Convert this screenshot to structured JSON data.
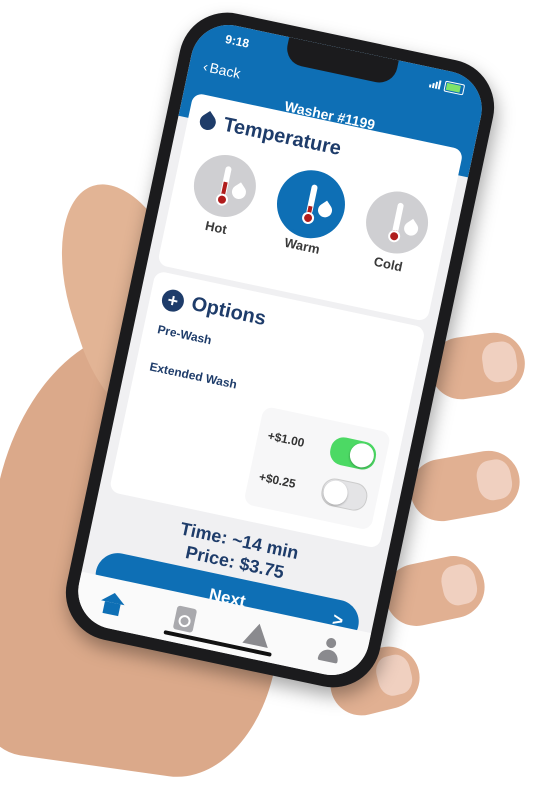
{
  "status": {
    "time": "9:18"
  },
  "header": {
    "back_label": "Back",
    "title": "Washer #1199"
  },
  "temperature": {
    "title": "Temperature",
    "options": [
      {
        "label": "Hot",
        "selected": false,
        "level": 0.75
      },
      {
        "label": "Warm",
        "selected": true,
        "level": 0.5
      },
      {
        "label": "Cold",
        "selected": false,
        "level": 0.25
      }
    ]
  },
  "options": {
    "title": "Options",
    "items": [
      {
        "label": "Pre-Wash",
        "price": "+$1.00",
        "enabled": true
      },
      {
        "label": "Extended Wash",
        "price": "+$0.25",
        "enabled": false
      }
    ]
  },
  "summary": {
    "time": "Time: ~14 min",
    "price": "Price: $3.75"
  },
  "next_button": {
    "label": "Next",
    "chevron": ">"
  },
  "tabbar": {
    "items": [
      "home-icon",
      "washer-icon",
      "warning-icon",
      "user-icon"
    ]
  },
  "colors": {
    "primary": "#0e6fb5",
    "toggle_on": "#4cd964",
    "heading": "#1e3c6a"
  }
}
